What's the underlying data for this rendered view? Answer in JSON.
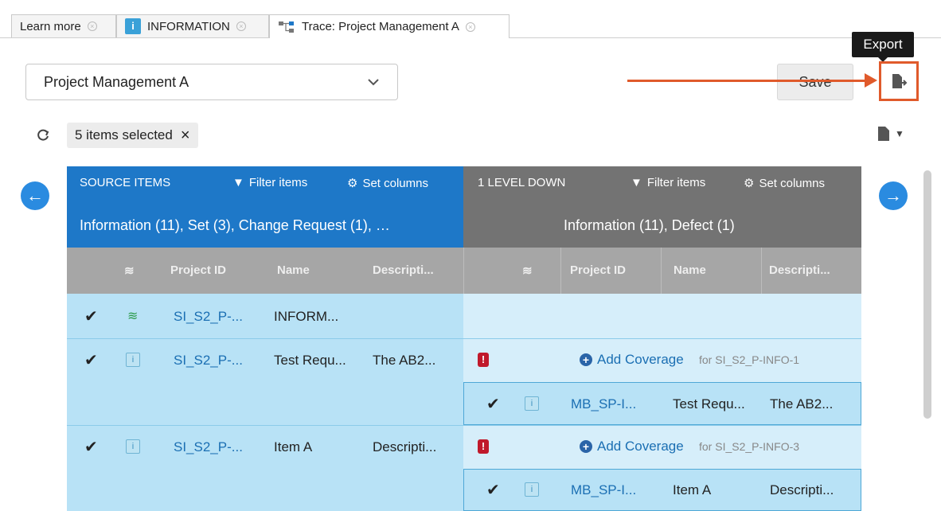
{
  "tabs": [
    {
      "label": "Learn more"
    },
    {
      "label": "INFORMATION"
    },
    {
      "label": "Trace: Project Management A"
    }
  ],
  "toolbar": {
    "project_select_value": "Project Management A",
    "save_label": "Save",
    "export_tooltip": "Export"
  },
  "selection": {
    "label": "5 items selected",
    "clear": "×"
  },
  "source": {
    "title": "SOURCE ITEMS",
    "filter_label": "Filter items",
    "columns_label": "Set columns",
    "subtitle": "Information (11), Set (3), Change Request (1), …",
    "headers": [
      "Project ID",
      "Name",
      "Descripti..."
    ]
  },
  "target": {
    "title": "1 LEVEL DOWN",
    "filter_label": "Filter items",
    "columns_label": "Set columns",
    "subtitle": "Information (11), Defect (1)",
    "headers": [
      "Project ID",
      "Name",
      "Descripti..."
    ]
  },
  "source_rows": [
    {
      "id": "SI_S2_P-...",
      "name": "INFORM...",
      "desc": ""
    },
    {
      "id": "SI_S2_P-...",
      "name": "Test Requ...",
      "desc": "The AB2..."
    },
    {
      "id": "SI_S2_P-...",
      "name": "Item A",
      "desc": "Descripti..."
    }
  ],
  "coverage": [
    {
      "label": "Add Coverage",
      "for": "for SI_S2_P-INFO-1"
    },
    {
      "label": "Add Coverage",
      "for": "for SI_S2_P-INFO-3"
    }
  ],
  "target_rows": [
    {
      "id": "MB_SP-I...",
      "name": "Test Requ...",
      "desc": "The AB2..."
    },
    {
      "id": "MB_SP-I...",
      "name": "Item A",
      "desc": "Descripti..."
    }
  ],
  "colors": {
    "accent": "#1e78c8",
    "annotation": "#e05a2b",
    "error": "#c0192b"
  }
}
